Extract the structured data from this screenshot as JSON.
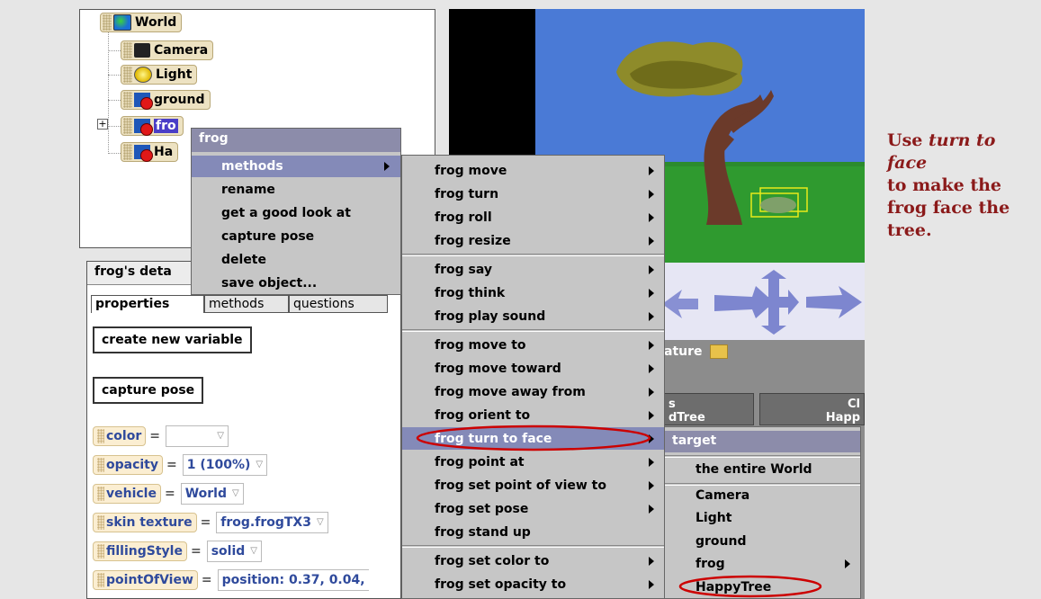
{
  "tree": {
    "root": "World",
    "items": [
      "Camera",
      "Light",
      "ground",
      "frog",
      "HappyTree"
    ],
    "frog_visible": "fro",
    "happytree_visible": "Ha"
  },
  "details": {
    "title": "frog's deta",
    "tabs": [
      "properties",
      "methods",
      "questions"
    ],
    "create_variable": "create new variable",
    "capture_pose": "capture pose",
    "properties": [
      {
        "name": "color",
        "value": ""
      },
      {
        "name": "opacity",
        "value": "1 (100%)"
      },
      {
        "name": "vehicle",
        "value": "World"
      },
      {
        "name": "skin texture",
        "value": "frog.frogTX3"
      },
      {
        "name": "fillingStyle",
        "value": "solid"
      },
      {
        "name": "pointOfView",
        "value": "position: 0.37, 0.04,"
      }
    ]
  },
  "scene_fragments": {
    "feature": "ature",
    "col1": "s",
    "col1b": "dTree",
    "col2": "Cl",
    "col2b": "Happ"
  },
  "context_menu": {
    "header": "frog",
    "items": [
      "methods",
      "rename",
      "get a good look at",
      "capture pose",
      "delete",
      "save object..."
    ]
  },
  "methods_menu": {
    "groups": [
      [
        "frog move",
        "frog turn",
        "frog roll",
        "frog resize"
      ],
      [
        "frog say",
        "frog think",
        "frog play sound"
      ],
      [
        "frog move to",
        "frog move  toward",
        "frog move  away from",
        "frog orient to",
        "frog turn to face",
        "frog point at",
        "frog set point of view to",
        "frog set pose",
        "frog stand up"
      ],
      [
        "frog set color to",
        "frog set opacity to"
      ]
    ]
  },
  "target_menu": {
    "header": "target",
    "items": [
      "the entire World",
      "Camera",
      "Light",
      "ground",
      "frog",
      "HappyTree"
    ]
  },
  "caption": {
    "line1": "Use ",
    "italic": "turn to face",
    "line2": "to make the frog face the tree."
  },
  "colors": {
    "annotation": "#cc0000",
    "caption": "#8b1a1a",
    "menu_selected": "#848ab8"
  }
}
